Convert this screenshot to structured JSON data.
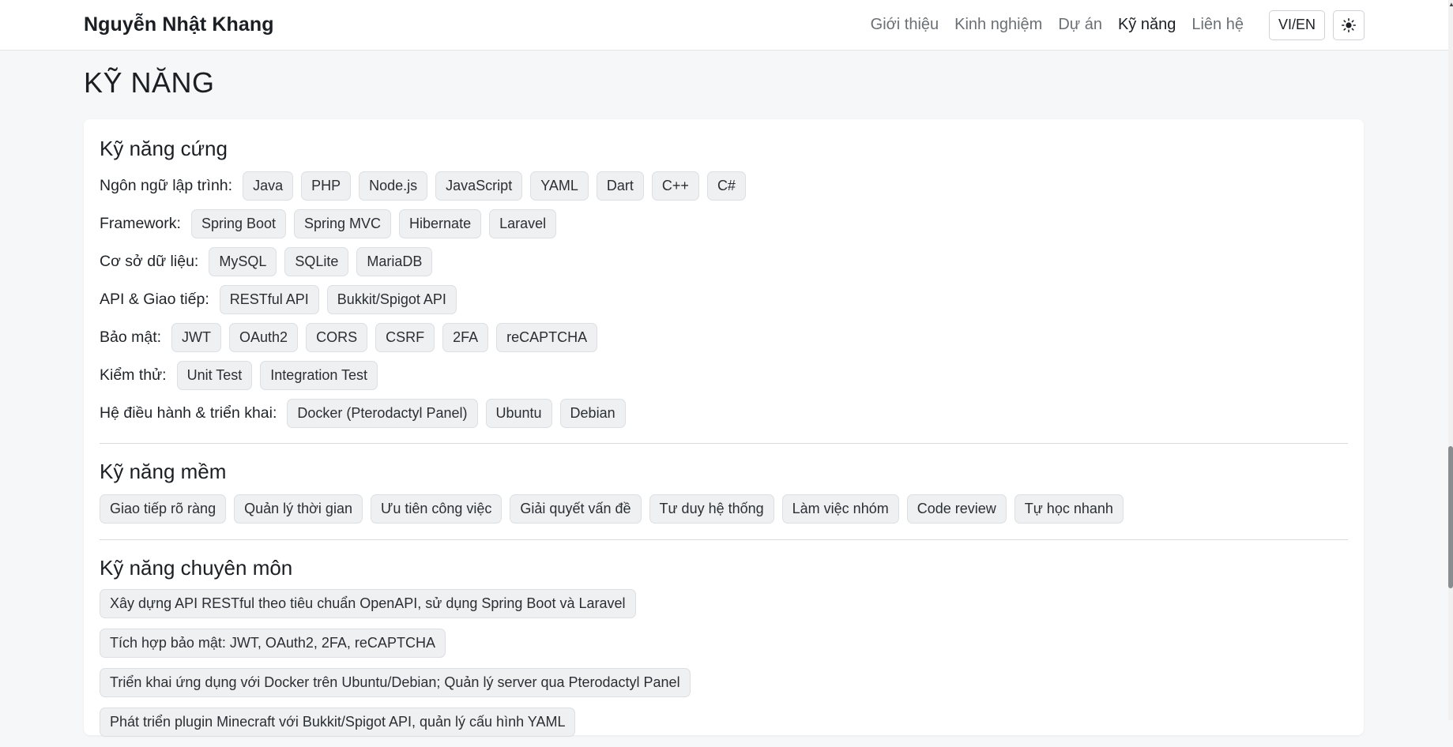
{
  "header": {
    "brand": "Nguyễn Nhật Khang",
    "nav": [
      "Giới thiệu",
      "Kinh nghiệm",
      "Dự án",
      "Kỹ năng",
      "Liên hệ"
    ],
    "active_nav": "Kỹ năng",
    "lang_label": "VI/EN",
    "theme_icon": "sun-icon"
  },
  "page": {
    "title": "KỸ NĂNG"
  },
  "hard_skills": {
    "title": "Kỹ năng cứng",
    "rows": [
      {
        "label": "Ngôn ngữ lập trình:",
        "chips": [
          "Java",
          "PHP",
          "Node.js",
          "JavaScript",
          "YAML",
          "Dart",
          "C++",
          "C#"
        ]
      },
      {
        "label": "Framework:",
        "chips": [
          "Spring Boot",
          "Spring MVC",
          "Hibernate",
          "Laravel"
        ]
      },
      {
        "label": "Cơ sở dữ liệu:",
        "chips": [
          "MySQL",
          "SQLite",
          "MariaDB"
        ]
      },
      {
        "label": "API & Giao tiếp:",
        "chips": [
          "RESTful API",
          "Bukkit/Spigot API"
        ]
      },
      {
        "label": "Bảo mật:",
        "chips": [
          "JWT",
          "OAuth2",
          "CORS",
          "CSRF",
          "2FA",
          "reCAPTCHA"
        ]
      },
      {
        "label": "Kiểm thử:",
        "chips": [
          "Unit Test",
          "Integration Test"
        ]
      },
      {
        "label": "Hệ điều hành & triển khai:",
        "chips": [
          "Docker (Pterodactyl Panel)",
          "Ubuntu",
          "Debian"
        ]
      }
    ]
  },
  "soft_skills": {
    "title": "Kỹ năng mềm",
    "chips": [
      "Giao tiếp rõ ràng",
      "Quản lý thời gian",
      "Ưu tiên công việc",
      "Giải quyết vấn đề",
      "Tư duy hệ thống",
      "Làm việc nhóm",
      "Code review",
      "Tự học nhanh"
    ]
  },
  "professional_skills": {
    "title": "Kỹ năng chuyên môn",
    "items": [
      "Xây dựng API RESTful theo tiêu chuẩn OpenAPI, sử dụng Spring Boot và Laravel",
      "Tích hợp bảo mật: JWT, OAuth2, 2FA, reCAPTCHA",
      "Triển khai ứng dụng với Docker trên Ubuntu/Debian; Quản lý server qua Pterodactyl Panel",
      "Phát triển plugin Minecraft với Bukkit/Spigot API, quản lý cấu hình YAML"
    ]
  }
}
